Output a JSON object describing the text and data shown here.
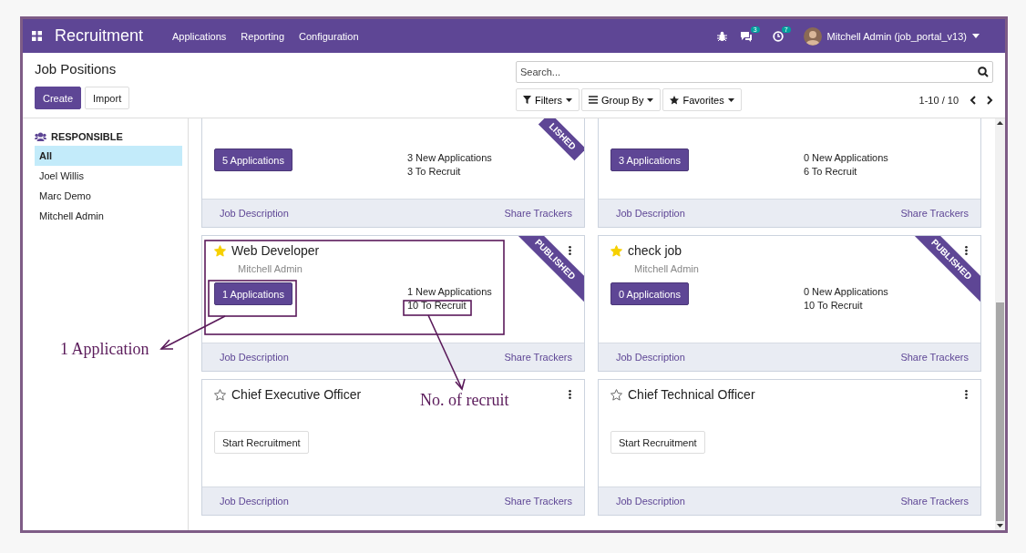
{
  "navbar": {
    "app_name": "Recruitment",
    "menu": [
      "Applications",
      "Reporting",
      "Configuration"
    ],
    "messages_badge": "3",
    "activities_badge": "7",
    "user": "Mitchell Admin (job_portal_v13)"
  },
  "control_panel": {
    "breadcrumb": "Job Positions",
    "buttons": [
      {
        "label": "Create",
        "kind": "primary"
      },
      {
        "label": "Import",
        "kind": "secondary"
      }
    ],
    "search": {
      "placeholder": "Search..."
    },
    "filters": [
      {
        "label": "Filters",
        "kind": "filter"
      },
      {
        "label": "Group By",
        "kind": "group"
      },
      {
        "label": "Favorites",
        "kind": "favorite"
      }
    ],
    "pager": "1-10 / 10"
  },
  "sidebar": {
    "title": "RESPONSIBLE",
    "items": [
      {
        "label": "All",
        "selected": true
      },
      {
        "label": "Joel Willis",
        "selected": false
      },
      {
        "label": "Marc Demo",
        "selected": false
      },
      {
        "label": "Mitchell Admin",
        "selected": false
      }
    ]
  },
  "cards": [
    {
      "ribbon": "LISHED",
      "button": {
        "label": "5 Applications",
        "kind": "applications"
      },
      "stats": [
        "3 New Applications",
        "3 To Recruit"
      ],
      "links": [
        "Job Description",
        "Share Trackers"
      ]
    },
    {
      "button": {
        "label": "3 Applications",
        "kind": "applications"
      },
      "stats": [
        "0 New Applications",
        "6 To Recruit"
      ],
      "links": [
        "Job Description",
        "Share Trackers"
      ]
    },
    {
      "title": "Web Developer",
      "favorite": true,
      "responsible": "Mitchell Admin",
      "ribbon": "PUBLISHED",
      "button": {
        "label": "1 Applications",
        "kind": "applications"
      },
      "stats": [
        "1 New Applications",
        "10 To Recruit"
      ],
      "links": [
        "Job Description",
        "Share Trackers"
      ]
    },
    {
      "title": "check job",
      "favorite": true,
      "responsible": "Mitchell Admin",
      "ribbon": "PUBLISHED",
      "button": {
        "label": "0 Applications",
        "kind": "applications"
      },
      "stats": [
        "0 New Applications",
        "10 To Recruit"
      ],
      "links": [
        "Job Description",
        "Share Trackers"
      ]
    },
    {
      "title": "Chief Executive Officer",
      "favorite": false,
      "button": {
        "label": "Start Recruitment",
        "kind": "start"
      },
      "links": [
        "Job Description",
        "Share Trackers"
      ]
    },
    {
      "title": "Chief Technical Officer",
      "favorite": false,
      "button": {
        "label": "Start Recruitment",
        "kind": "start"
      },
      "links": [
        "Job Description",
        "Share Trackers"
      ]
    }
  ],
  "annotations": [
    {
      "text": "1 Application"
    },
    {
      "text": "No. of recruit"
    }
  ]
}
